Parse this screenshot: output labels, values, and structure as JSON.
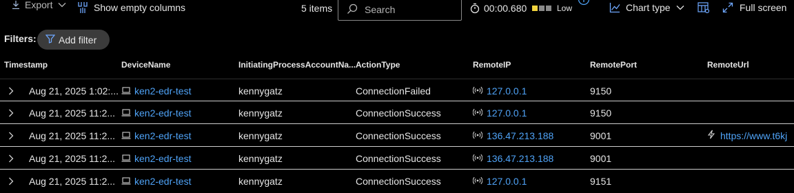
{
  "toolbar": {
    "export_label": "Export",
    "show_empty_label": "Show empty columns",
    "items_count": "5 items",
    "search_placeholder": "Search",
    "elapsed": "00:00.680",
    "perf_label": "Low",
    "chart_type_label": "Chart type",
    "full_screen_label": "Full screen"
  },
  "filters": {
    "label": "Filters:",
    "add_filter_label": "Add filter"
  },
  "colors": {
    "link": "#4fa3f7",
    "perf_active": "#f2d43d",
    "perf_inactive": "#8a8a8a"
  },
  "table": {
    "columns": [
      "Timestamp",
      "DeviceName",
      "InitiatingProcessAccountNa...",
      "ActionType",
      "RemoteIP",
      "RemotePort",
      "RemoteUrl"
    ],
    "rows": [
      {
        "timestamp": "Aug 21, 2025 1:02:...",
        "device": "ken2-edr-test",
        "account": "kennygatz",
        "action": "ConnectionFailed",
        "ip": "127.0.0.1",
        "port": "9150",
        "url": ""
      },
      {
        "timestamp": "Aug 21, 2025 11:2...",
        "device": "ken2-edr-test",
        "account": "kennygatz",
        "action": "ConnectionSuccess",
        "ip": "127.0.0.1",
        "port": "9150",
        "url": ""
      },
      {
        "timestamp": "Aug 21, 2025 11:2...",
        "device": "ken2-edr-test",
        "account": "kennygatz",
        "action": "ConnectionSuccess",
        "ip": "136.47.213.188",
        "port": "9001",
        "url": "https://www.t6kj"
      },
      {
        "timestamp": "Aug 21, 2025 11:2...",
        "device": "ken2-edr-test",
        "account": "kennygatz",
        "action": "ConnectionSuccess",
        "ip": "136.47.213.188",
        "port": "9001",
        "url": ""
      },
      {
        "timestamp": "Aug 21, 2025 11:2...",
        "device": "ken2-edr-test",
        "account": "kennygatz",
        "action": "ConnectionSuccess",
        "ip": "127.0.0.1",
        "port": "9151",
        "url": ""
      }
    ]
  }
}
